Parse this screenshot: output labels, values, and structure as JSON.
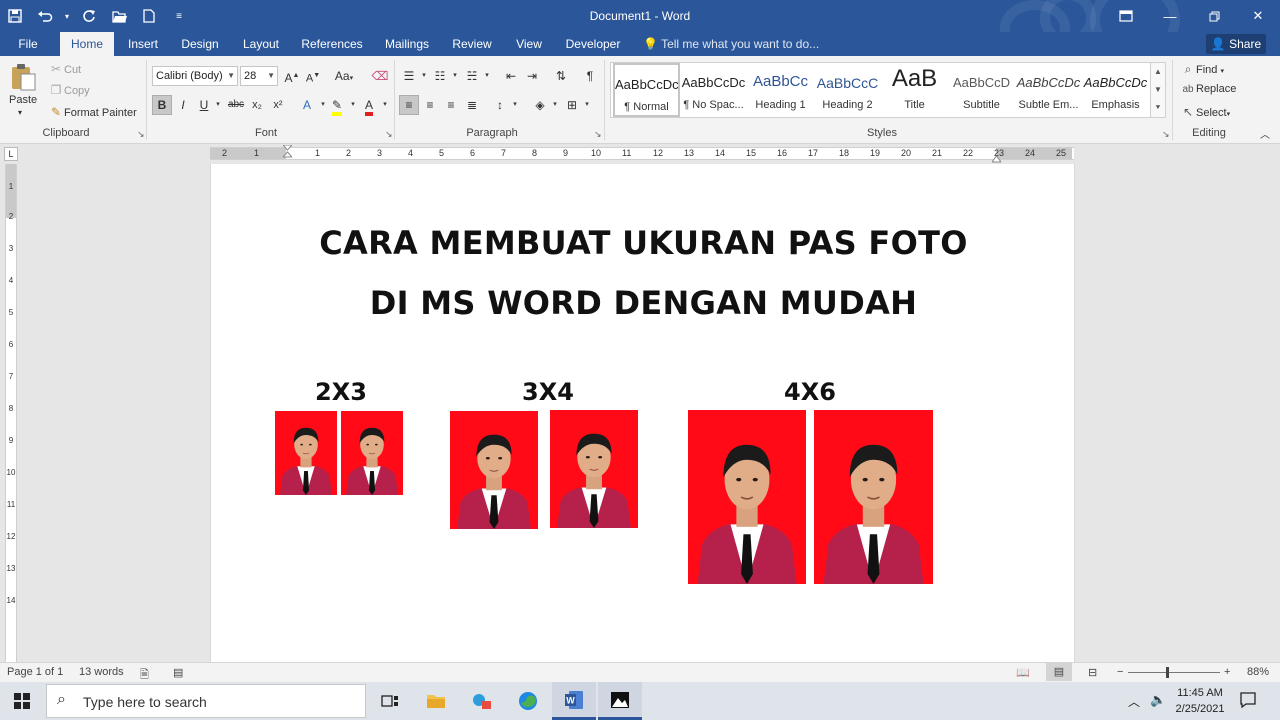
{
  "titlebar": {
    "title": "Document1 - Word"
  },
  "tabs": [
    {
      "label": "File"
    },
    {
      "label": "Home"
    },
    {
      "label": "Insert"
    },
    {
      "label": "Design"
    },
    {
      "label": "Layout"
    },
    {
      "label": "References"
    },
    {
      "label": "Mailings"
    },
    {
      "label": "Review"
    },
    {
      "label": "View"
    },
    {
      "label": "Developer"
    }
  ],
  "tellme": "Tell me what you want to do...",
  "share": "Share",
  "clipboard": {
    "paste": "Paste",
    "cut": "Cut",
    "copy": "Copy",
    "format_painter": "Format Painter",
    "group": "Clipboard"
  },
  "font": {
    "name": "Calibri (Body)",
    "size": "28",
    "group": "Font",
    "case_label": "Aa"
  },
  "paragraph": {
    "group": "Paragraph"
  },
  "styles": {
    "group": "Styles",
    "items": [
      {
        "preview": "AaBbCcDc",
        "name": "¶ Normal"
      },
      {
        "preview": "AaBbCcDc",
        "name": "¶ No Spac..."
      },
      {
        "preview": "AaBbCc",
        "name": "Heading 1"
      },
      {
        "preview": "AaBbCcC",
        "name": "Heading 2"
      },
      {
        "preview": "AaB",
        "name": "Title"
      },
      {
        "preview": "AaBbCcD",
        "name": "Subtitle"
      },
      {
        "preview": "AaBbCcDc",
        "name": "Subtle Em..."
      },
      {
        "preview": "AaBbCcDc",
        "name": "Emphasis"
      }
    ]
  },
  "editing": {
    "find": "Find",
    "replace": "Replace",
    "select": "Select",
    "group": "Editing"
  },
  "ruler": {
    "ticks": [
      "2",
      "1",
      "1",
      "2",
      "3",
      "4",
      "5",
      "6",
      "7",
      "8",
      "9",
      "10",
      "11",
      "12",
      "13",
      "14",
      "15",
      "16",
      "17",
      "18",
      "19",
      "20",
      "21",
      "22",
      "23",
      "24",
      "25"
    ],
    "vticks": [
      "1",
      "2",
      "3",
      "4",
      "5",
      "6",
      "7",
      "8",
      "9",
      "10",
      "11",
      "12",
      "13",
      "14"
    ]
  },
  "document": {
    "heading_line1": "CARA MEMBUAT UKURAN PAS FOTO",
    "heading_line2": "DI MS WORD DENGAN MUDAH",
    "sizes": [
      "2X3",
      "3X4",
      "4X6"
    ]
  },
  "statusbar": {
    "page": "Page 1 of 1",
    "words": "13 words",
    "zoom": "88%"
  },
  "taskbar": {
    "search_placeholder": "Type here to search",
    "time": "11:45 AM",
    "date": "2/25/2021"
  },
  "colors": {
    "word_blue": "#2b579a",
    "photo_bg": "#ff0a16",
    "blazer": "#b5214a"
  }
}
